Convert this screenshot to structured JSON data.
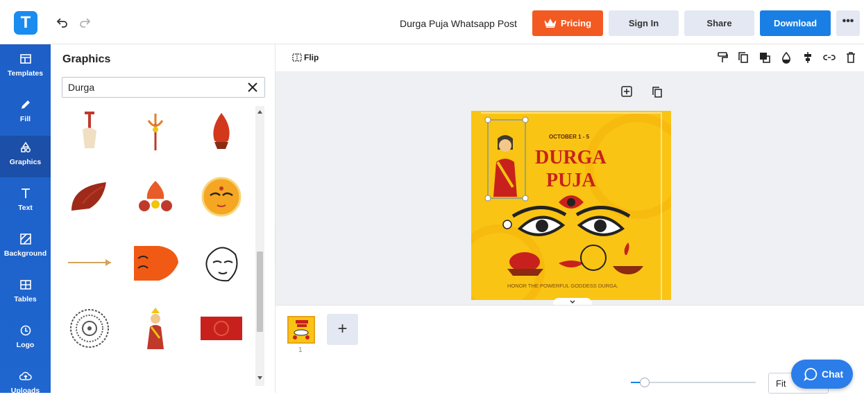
{
  "app": {
    "logo_letter": "T",
    "doc_title": "Durga Puja Whatsapp Post"
  },
  "header": {
    "pricing_label": "Pricing",
    "signin_label": "Sign In",
    "share_label": "Share",
    "download_label": "Download",
    "more_label": "•••"
  },
  "sidebar": {
    "items": [
      {
        "label": "Templates",
        "icon": "templates-icon"
      },
      {
        "label": "Fill",
        "icon": "pencil-icon"
      },
      {
        "label": "Graphics",
        "icon": "shapes-icon",
        "active": true
      },
      {
        "label": "Text",
        "icon": "text-icon"
      },
      {
        "label": "Background",
        "icon": "background-icon"
      },
      {
        "label": "Tables",
        "icon": "table-icon"
      },
      {
        "label": "Logo",
        "icon": "logo-icon"
      },
      {
        "label": "Uploads",
        "icon": "cloud-upload-icon"
      }
    ]
  },
  "panel": {
    "title": "Graphics",
    "search_value": "Durga"
  },
  "toolbar": {
    "flip_label": "Flip"
  },
  "poster": {
    "date": "OCTOBER 1 - 5",
    "title_line1": "DURGA",
    "title_line2": "PUJA",
    "tagline": "HONOR THE POWERFUL GODDESS DURGA."
  },
  "pages": {
    "page_number": "1",
    "add_label": "+"
  },
  "zoom": {
    "fit_label": "Fit"
  },
  "chat": {
    "label": "Chat"
  },
  "colors": {
    "accent": "#1a7fe4",
    "pricing": "#f25a22",
    "poster_bg": "#f9c414",
    "poster_red": "#c8211d"
  }
}
